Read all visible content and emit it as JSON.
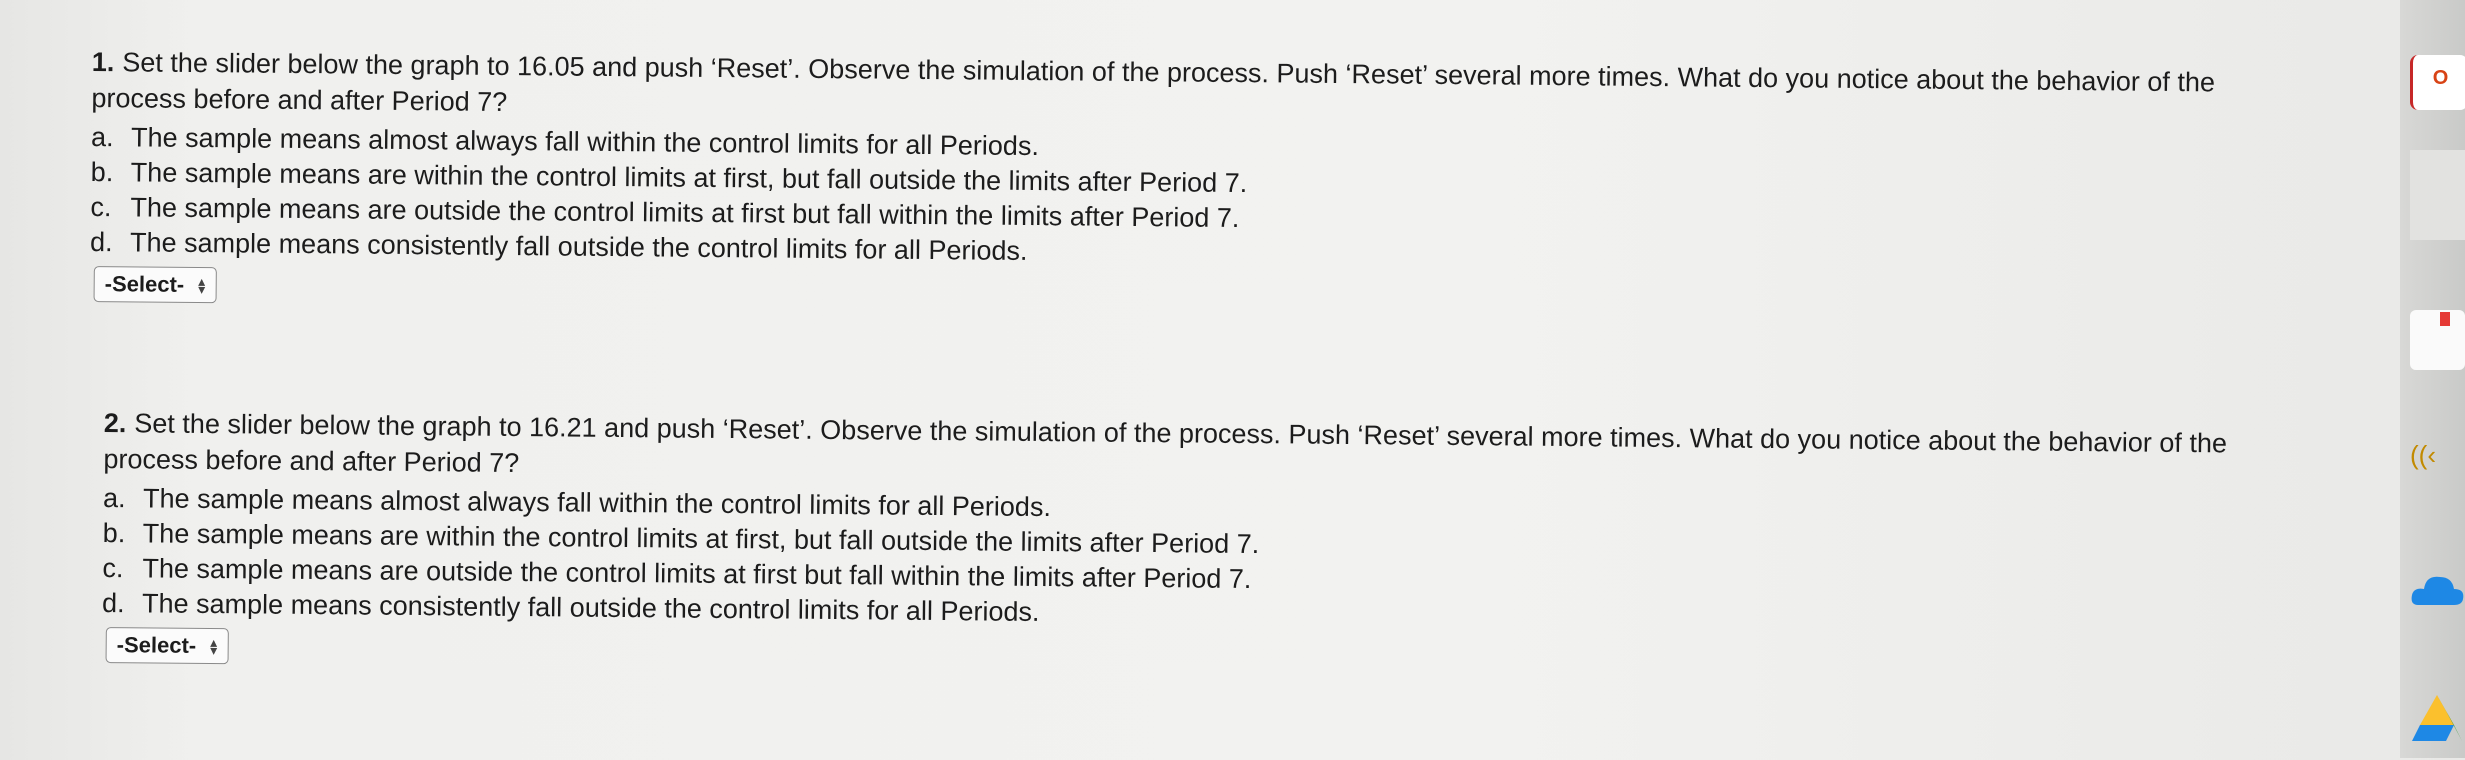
{
  "questions": [
    {
      "number": "1.",
      "stem": "Set the slider below the graph to 16.05 and push ‘Reset’. Observe the simulation of the process. Push ‘Reset’ several more times. What do you notice about the behavior of the process before and after Period 7?",
      "options": [
        {
          "letter": "a.",
          "text": "The sample means almost always fall within the control limits for all Periods."
        },
        {
          "letter": "b.",
          "text": "The sample means are within the control limits at first, but fall outside the limits after Period 7."
        },
        {
          "letter": "c.",
          "text": "The sample means are outside the control limits at first but fall within the limits after Period 7."
        },
        {
          "letter": "d.",
          "text": "The sample means consistently fall outside the control limits for all Periods."
        }
      ],
      "select_value": "-Select-"
    },
    {
      "number": "2.",
      "stem": "Set the slider below the graph to 16.21 and push ‘Reset’. Observe the simulation of the process. Push ‘Reset’ several more times. What do you notice about the behavior of the process before and after Period 7?",
      "options": [
        {
          "letter": "a.",
          "text": "The sample means almost always fall within the control limits for all Periods."
        },
        {
          "letter": "b.",
          "text": "The sample means are within the control limits at first, but fall outside the limits after Period 7."
        },
        {
          "letter": "c.",
          "text": "The sample means are outside the control limits at first but fall within the limits after Period 7."
        },
        {
          "letter": "d.",
          "text": "The sample means consistently fall outside the control limits for all Periods."
        }
      ],
      "select_value": "-Select-"
    }
  ],
  "dock": {
    "items": [
      "office-app-icon",
      "blank-app-icon",
      "notes-app-icon",
      "wireless-icon",
      "onedrive-cloud-icon",
      "google-drive-icon"
    ],
    "office_glyph": "O",
    "wireless_glyph": "((‹"
  }
}
